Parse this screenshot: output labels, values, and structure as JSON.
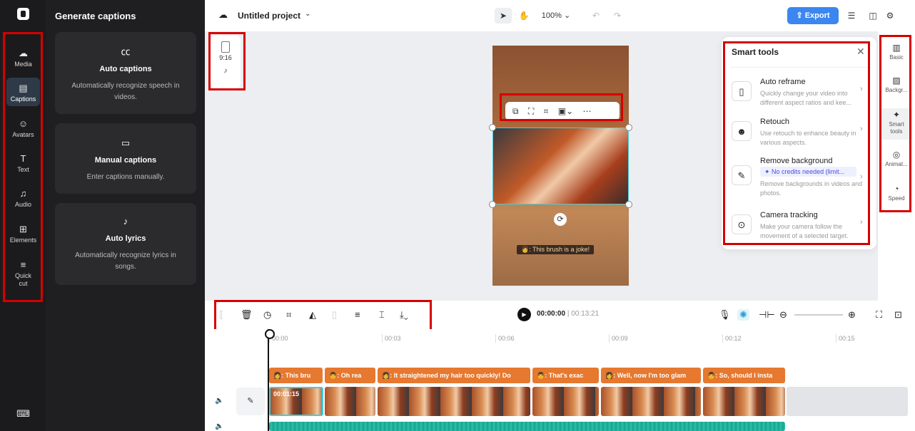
{
  "left_rail": {
    "items": [
      {
        "label": "Media",
        "icon": "cloud-upload-icon"
      },
      {
        "label": "Captions",
        "icon": "captions-icon"
      },
      {
        "label": "Avatars",
        "icon": "avatar-icon"
      },
      {
        "label": "Text",
        "icon": "text-icon"
      },
      {
        "label": "Audio",
        "icon": "music-icon"
      },
      {
        "label": "Elements",
        "icon": "elements-icon"
      },
      {
        "label": "Quick cut",
        "icon": "quick-cut-icon"
      }
    ],
    "active": "Captions"
  },
  "panel": {
    "title": "Generate captions",
    "cards": [
      {
        "title": "Auto captions",
        "desc": "Automatically recognize speech in videos.",
        "icon": "cc-icon"
      },
      {
        "title": "Manual captions",
        "desc": "Enter captions manually.",
        "icon": "keyboard-icon"
      },
      {
        "title": "Auto lyrics",
        "desc": "Automatically recognize lyrics in songs.",
        "icon": "lyrics-icon"
      }
    ]
  },
  "topbar": {
    "project_name": "Untitled project",
    "zoom": "100%",
    "export_label": "Export"
  },
  "canvas": {
    "ratio_label": "9:16",
    "caption_text": "👩: This brush is a joke!"
  },
  "smart_tools": {
    "title": "Smart tools",
    "items": [
      {
        "name": "Auto reframe",
        "desc": "Quickly change your video into different aspect ratios and kee..."
      },
      {
        "name": "Retouch",
        "desc": "Use retouch to enhance beauty in various aspects."
      },
      {
        "name": "Remove background",
        "badge": "✦ No credits needed (limit...",
        "desc": "Remove backgrounds in videos and photos."
      },
      {
        "name": "Camera tracking",
        "desc": "Make your camera follow the movement of a selected target."
      }
    ]
  },
  "right_rail": {
    "items": [
      {
        "label": "Basic"
      },
      {
        "label": "Backgr..."
      },
      {
        "label": "Smart tools"
      },
      {
        "label": "Animat..."
      },
      {
        "label": "Speed"
      }
    ],
    "active": "Smart tools"
  },
  "timeline": {
    "current_time": "00:00:00",
    "total_time": "00:13:21",
    "ticks": [
      "00:00",
      "00:03",
      "00:06",
      "00:09",
      "00:12",
      "00:15"
    ],
    "clip_time": "00:01:15",
    "captions": [
      "👩: This bru",
      "👨: Oh rea",
      "👩: It straightened my hair too quickly! Do",
      "👨: That's exac",
      "👩: Well, now I'm too glam",
      "👨: So, should I insta"
    ]
  }
}
